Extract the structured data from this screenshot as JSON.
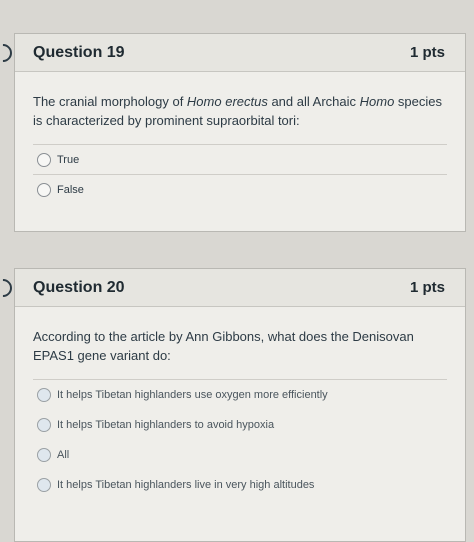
{
  "questions": [
    {
      "title": "Question 19",
      "points": "1 pts",
      "text_parts": [
        "The cranial morphology of ",
        "Homo erectus",
        " and all Archaic ",
        "Homo",
        " species is characterized by prominent supraorbital tori:"
      ],
      "answers": [
        "True",
        "False"
      ]
    },
    {
      "title": "Question 20",
      "points": "1 pts",
      "text": "According to the article by Ann Gibbons, what does the Denisovan EPAS1 gene variant do:",
      "answers": [
        "It helps Tibetan highlanders use oxygen more efficiently",
        "It helps Tibetan highlanders to avoid hypoxia",
        "All",
        "It helps Tibetan highlanders live in very high altitudes"
      ]
    }
  ]
}
